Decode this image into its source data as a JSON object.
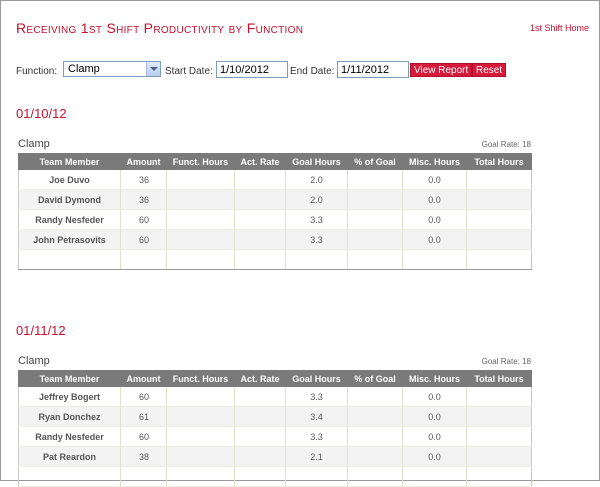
{
  "header": {
    "title": "Receiving 1st Shift Productivity by Function",
    "home_link": "1st Shift Home"
  },
  "filters": {
    "function_label": "Function:",
    "function_value": "Clamp",
    "start_label": "Start Date:",
    "start_value": "1/10/2012",
    "end_label": "End Date:",
    "end_value": "1/11/2012",
    "view_button": "View Report",
    "reset_button": "Reset"
  },
  "columns": [
    "Team Member",
    "Amount",
    "Funct. Hours",
    "Act. Rate",
    "Goal Hours",
    "% of Goal",
    "Misc. Hours",
    "Total Hours"
  ],
  "reports": [
    {
      "date": "01/10/12",
      "function": "Clamp",
      "goal_rate": "Goal Rate: 18",
      "rows": [
        {
          "name": "Joe Duvo",
          "amount": "36",
          "funct_hours": "",
          "act_rate": "",
          "goal_hours": "2.0",
          "pct_goal": "",
          "misc_hours": "0.0",
          "total_hours": ""
        },
        {
          "name": "David Dymond",
          "amount": "36",
          "funct_hours": "",
          "act_rate": "",
          "goal_hours": "2.0",
          "pct_goal": "",
          "misc_hours": "0.0",
          "total_hours": ""
        },
        {
          "name": "Randy Nesfeder",
          "amount": "60",
          "funct_hours": "",
          "act_rate": "",
          "goal_hours": "3.3",
          "pct_goal": "",
          "misc_hours": "0.0",
          "total_hours": ""
        },
        {
          "name": "John Petrasovits",
          "amount": "60",
          "funct_hours": "",
          "act_rate": "",
          "goal_hours": "3.3",
          "pct_goal": "",
          "misc_hours": "0.0",
          "total_hours": ""
        }
      ]
    },
    {
      "date": "01/11/12",
      "function": "Clamp",
      "goal_rate": "Goal Rate: 18",
      "rows": [
        {
          "name": "Jeffrey Bogert",
          "amount": "60",
          "funct_hours": "",
          "act_rate": "",
          "goal_hours": "3.3",
          "pct_goal": "",
          "misc_hours": "0.0",
          "total_hours": ""
        },
        {
          "name": "Ryan Donchez",
          "amount": "61",
          "funct_hours": "",
          "act_rate": "",
          "goal_hours": "3.4",
          "pct_goal": "",
          "misc_hours": "0.0",
          "total_hours": ""
        },
        {
          "name": "Randy Nesfeder",
          "amount": "60",
          "funct_hours": "",
          "act_rate": "",
          "goal_hours": "3.3",
          "pct_goal": "",
          "misc_hours": "0.0",
          "total_hours": ""
        },
        {
          "name": "Pat Reardon",
          "amount": "38",
          "funct_hours": "",
          "act_rate": "",
          "goal_hours": "2.1",
          "pct_goal": "",
          "misc_hours": "0.0",
          "total_hours": ""
        }
      ]
    }
  ],
  "icons": {
    "dropdown": "chevron-down-icon"
  },
  "colors": {
    "accent": "#c8102e",
    "button": "#d7193a",
    "table_header": "#7a7a7a"
  }
}
